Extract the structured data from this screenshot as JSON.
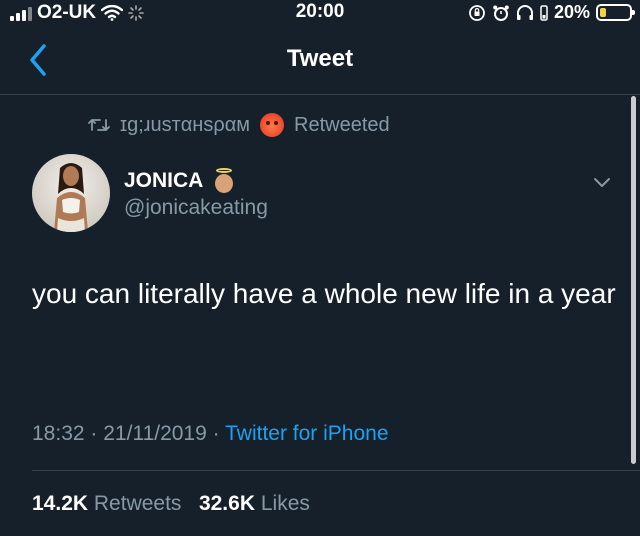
{
  "status_bar": {
    "carrier": "O2-UK",
    "time": "20:00",
    "battery": "20%",
    "battery_level": 0.2,
    "battery_color": "#f5d04a",
    "icons": [
      "signal-icon",
      "wifi-icon",
      "loading-icon",
      "orientation-lock-icon",
      "alarm-icon",
      "headphones-icon",
      "battery-icon"
    ]
  },
  "nav": {
    "title": "Tweet",
    "back_icon": "chevron-left-icon",
    "accent": "#1da1f2"
  },
  "retweet": {
    "user": "ɪg;ɹuѕтαнѕραм",
    "label": "Retweeted",
    "icon": "retweet-icon",
    "emoji": "hot-face-emoji"
  },
  "author": {
    "name": "JONICA",
    "handle": "@jonicakeating",
    "name_emoji": "angel-emoji"
  },
  "tweet": {
    "text": "you can literally have a whole new life in a year"
  },
  "meta": {
    "time": "18:32",
    "separator": "·",
    "date": "21/11/2019",
    "source": "Twitter for iPhone"
  },
  "stats": {
    "retweets_count": "14.2K",
    "retweets_label": "Retweets",
    "likes_count": "32.6K",
    "likes_label": "Likes"
  },
  "colors": {
    "background": "#15202b",
    "secondary_text": "#8899a6",
    "divider": "#38444d",
    "link": "#1da1f2"
  }
}
